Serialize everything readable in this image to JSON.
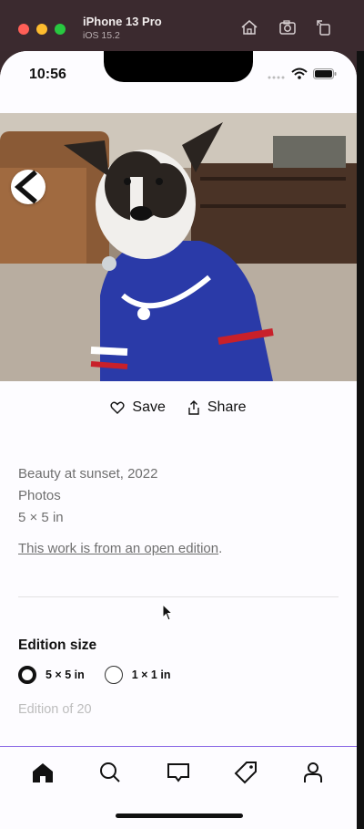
{
  "simulator": {
    "device_name": "iPhone 13 Pro",
    "os_version": "iOS 15.2",
    "toolbar_icons": [
      "home-icon",
      "screenshot-icon",
      "rotate-icon"
    ]
  },
  "status_bar": {
    "time": "10:56"
  },
  "hero_image": {
    "description_icon": "dog-photo"
  },
  "actions": {
    "save_label": "Save",
    "share_label": "Share"
  },
  "artwork": {
    "title_line": "Beauty at sunset, 2022",
    "medium": "Photos",
    "size": "5 × 5 in",
    "open_edition_link": "This work is from an open edition",
    "open_edition_suffix": "."
  },
  "edition": {
    "heading": "Edition size",
    "options": [
      {
        "label": "5 × 5 in",
        "selected": true
      },
      {
        "label": "1 × 1 in",
        "selected": false
      }
    ],
    "count_text": "Edition of 20"
  },
  "tab_bar": {
    "items": [
      "home-icon",
      "search-icon",
      "messages-icon",
      "offers-icon",
      "profile-icon"
    ],
    "accent_color": "#8e6ce6"
  }
}
